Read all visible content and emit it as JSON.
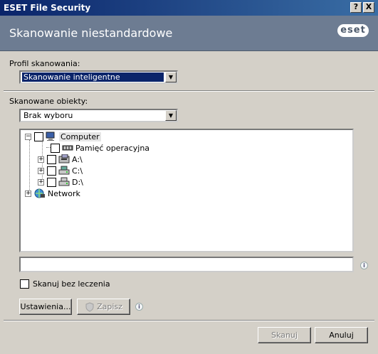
{
  "window": {
    "title": "ESET File Security",
    "help_btn": "?",
    "close_btn": "X"
  },
  "header": {
    "title": "Skanowanie niestandardowe",
    "logo": "eset"
  },
  "profile": {
    "label": "Profil skanowania:",
    "value": "Skanowanie inteligentne"
  },
  "targets": {
    "label": "Skanowane obiekty:",
    "value": "Brak wyboru"
  },
  "tree": {
    "root": "Computer",
    "items": [
      {
        "label": "Pamięć operacyjna",
        "icon": "memory-icon",
        "expandable": false
      },
      {
        "label": "A:\\",
        "icon": "floppy-drive-icon",
        "expandable": true
      },
      {
        "label": "C:\\",
        "icon": "hard-drive-icon",
        "expandable": true
      },
      {
        "label": "D:\\",
        "icon": "hard-drive-icon",
        "expandable": true
      }
    ],
    "network": "Network"
  },
  "path_input": {
    "value": ""
  },
  "options": {
    "no_clean_label": "Skanuj bez leczenia"
  },
  "buttons": {
    "settings": "Ustawienia...",
    "save": "Zapisz",
    "scan": "Skanuj",
    "cancel": "Anuluj"
  },
  "colors": {
    "header_bg": "#6d7c92",
    "title_bar": "#0a246a",
    "selection": "#0a246a"
  }
}
